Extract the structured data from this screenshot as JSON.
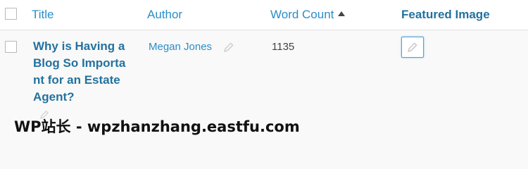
{
  "table": {
    "columns": [
      {
        "label": "Title"
      },
      {
        "label": "Author"
      },
      {
        "label": "Word Count",
        "sorted": "asc"
      },
      {
        "label": "Featured Image"
      }
    ],
    "rows": [
      {
        "title": "Why is Having a Blog So Important for an Estate Agent?",
        "author": "Megan Jones",
        "word_count": "1135",
        "edit_icon": "pencil-icon"
      }
    ]
  },
  "watermark": {
    "text": "WP站长 - wpzhanzhang.eastfu.com"
  },
  "colors": {
    "link": "#2a8ec8",
    "title_link": "#23729f",
    "row_bg": "#f9f9f9"
  }
}
